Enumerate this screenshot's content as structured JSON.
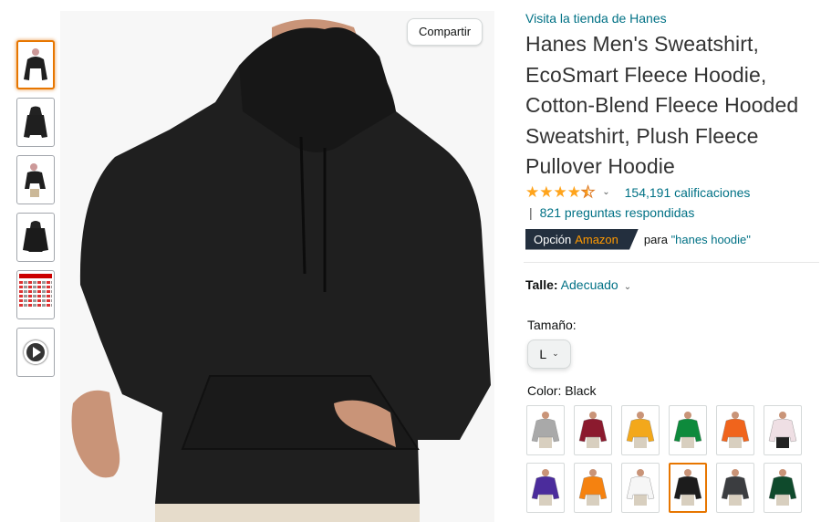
{
  "share_label": "Compartir",
  "store_link": "Visita la tienda de Hanes",
  "title": "Hanes Men's Sweatshirt, EcoSmart Fleece Hoodie, Cotton-Blend Fleece Hooded Sweatshirt, Plush Fleece Pullover Hoodie",
  "rating": {
    "value": 4.5,
    "count_text": "154,191 calificaciones",
    "star_icon": "star-icon",
    "color": "#ffa41c"
  },
  "questions_text": "821 preguntas respondidas",
  "questions_sep": "|",
  "choice": {
    "badge_prefix": "Opción",
    "badge_brand": "Amazon",
    "for_text": "para",
    "keyword": "\"hanes hoodie\""
  },
  "fit": {
    "label": "Talle:",
    "value": "Adecuado"
  },
  "size": {
    "label": "Tamaño:",
    "value": "L"
  },
  "color": {
    "label": "Color:",
    "value": "Black"
  },
  "swatches": [
    {
      "name": "Light Steel",
      "hex": "#a9a9a9"
    },
    {
      "name": "Maroon",
      "hex": "#8b1a2e"
    },
    {
      "name": "Gold",
      "hex": "#f3a81b"
    },
    {
      "name": "Kelly Green",
      "hex": "#0e8a3c"
    },
    {
      "name": "Orange",
      "hex": "#f0641c"
    },
    {
      "name": "Pale Pink",
      "hex": "#efdfe4"
    },
    {
      "name": "Purple",
      "hex": "#4b2c9c"
    },
    {
      "name": "Safety Orange",
      "hex": "#f58210"
    },
    {
      "name": "White",
      "hex": "#f6f6f6"
    },
    {
      "name": "Black",
      "hex": "#1c1c1c"
    },
    {
      "name": "Charcoal Heather",
      "hex": "#3b3d40"
    },
    {
      "name": "Deep Forest",
      "hex": "#0f4a2c"
    }
  ],
  "colors": {
    "link": "#007185",
    "accent": "#e77600",
    "badge_bg": "#232f3e",
    "badge_brand": "#ff9900",
    "main_product": "#1f1f1f"
  },
  "thumbnails": [
    "hoodie-front",
    "hoodie-back",
    "hoodie-model",
    "hoodie-flat",
    "size-chart",
    "video-play-icon"
  ]
}
